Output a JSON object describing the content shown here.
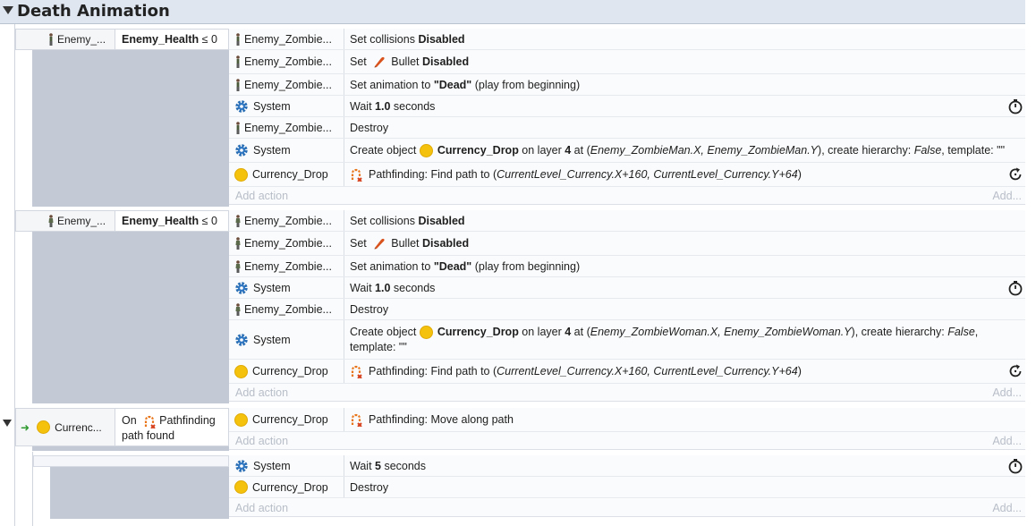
{
  "group": {
    "title": "Death Animation"
  },
  "events": [
    {
      "cond_obj": "Enemy_...",
      "cond_var": "Enemy_Health",
      "cond_op": "≤ 0",
      "actions": [
        {
          "obj": "Enemy_Zombie...",
          "kind": "zombieman",
          "p1": "Set collisions ",
          "b1": "Disabled"
        },
        {
          "obj": "Enemy_Zombie...",
          "kind": "zombieman",
          "p1": "Set ",
          "mid": "Bullet ",
          "b1": "Disabled"
        },
        {
          "obj": "Enemy_Zombie...",
          "kind": "zombieman",
          "p1": "Set animation to ",
          "b1": "\"Dead\"",
          "p2": " (play from beginning)"
        },
        {
          "obj": "System",
          "kind": "system",
          "p1": "Wait ",
          "b1": "1.0",
          "p2": " seconds"
        },
        {
          "obj": "Enemy_Zombie...",
          "kind": "zombieman",
          "p1": "Destroy"
        },
        {
          "obj": "System",
          "kind": "system",
          "p1": "Create object ",
          "b1": "Currency_Drop",
          "p2": " on layer ",
          "b2": "4",
          "p3": " at (",
          "i1": "Enemy_ZombieMan.X, Enemy_ZombieMan.Y",
          "p4": "), create hierarchy: ",
          "i2": "False",
          "p5": ", template: \"\""
        },
        {
          "obj": "Currency_Drop",
          "kind": "coin",
          "p1": "Pathfinding: Find path to (",
          "i1": "CurrentLevel_Currency.X+160, CurrentLevel_Currency.Y+64",
          "p2": ")"
        }
      ],
      "add_action": "Add action",
      "add_short": "Add..."
    },
    {
      "cond_obj": "Enemy_...",
      "cond_var": "Enemy_Health",
      "cond_op": "≤ 0",
      "actions": [
        {
          "obj": "Enemy_Zombie...",
          "kind": "zombiewoman",
          "p1": "Set collisions ",
          "b1": "Disabled"
        },
        {
          "obj": "Enemy_Zombie...",
          "kind": "zombiewoman",
          "p1": "Set ",
          "mid": "Bullet ",
          "b1": "Disabled"
        },
        {
          "obj": "Enemy_Zombie...",
          "kind": "zombiewoman",
          "p1": "Set animation to ",
          "b1": "\"Dead\"",
          "p2": " (play from beginning)"
        },
        {
          "obj": "System",
          "kind": "system",
          "p1": "Wait ",
          "b1": "1.0",
          "p2": " seconds"
        },
        {
          "obj": "Enemy_Zombie...",
          "kind": "zombiewoman",
          "p1": "Destroy"
        },
        {
          "obj": "System",
          "kind": "system",
          "p1": "Create object ",
          "b1": "Currency_Drop",
          "p2": " on layer ",
          "b2": "4",
          "p3": " at (",
          "i1": "Enemy_ZombieWoman.X, Enemy_ZombieWoman.Y",
          "p4": "), create hierarchy: ",
          "i2": "False",
          "p5": ",",
          "p6": "template: \"\""
        },
        {
          "obj": "Currency_Drop",
          "kind": "coin",
          "p1": "Pathfinding: Find path to (",
          "i1": "CurrentLevel_Currency.X+160, CurrentLevel_Currency.Y+64",
          "p2": ")"
        }
      ],
      "add_action": "Add action",
      "add_short": "Add..."
    },
    {
      "cond_obj": "Currenc...",
      "cond_trigger_1": "On",
      "cond_trigger_2": "Pathfinding",
      "cond_trigger_3": "path found",
      "actions": [
        {
          "obj": "Currency_Drop",
          "kind": "coin",
          "p1": "Pathfinding: Move along path"
        }
      ],
      "add_action": "Add action",
      "add_short": "Add..."
    },
    {
      "actions": [
        {
          "obj": "System",
          "kind": "system",
          "p1": "Wait ",
          "b1": "5",
          "p2": " seconds"
        },
        {
          "obj": "Currency_Drop",
          "kind": "coin",
          "p1": "Destroy"
        }
      ],
      "add_action": "Add action",
      "add_short": "Add..."
    }
  ]
}
